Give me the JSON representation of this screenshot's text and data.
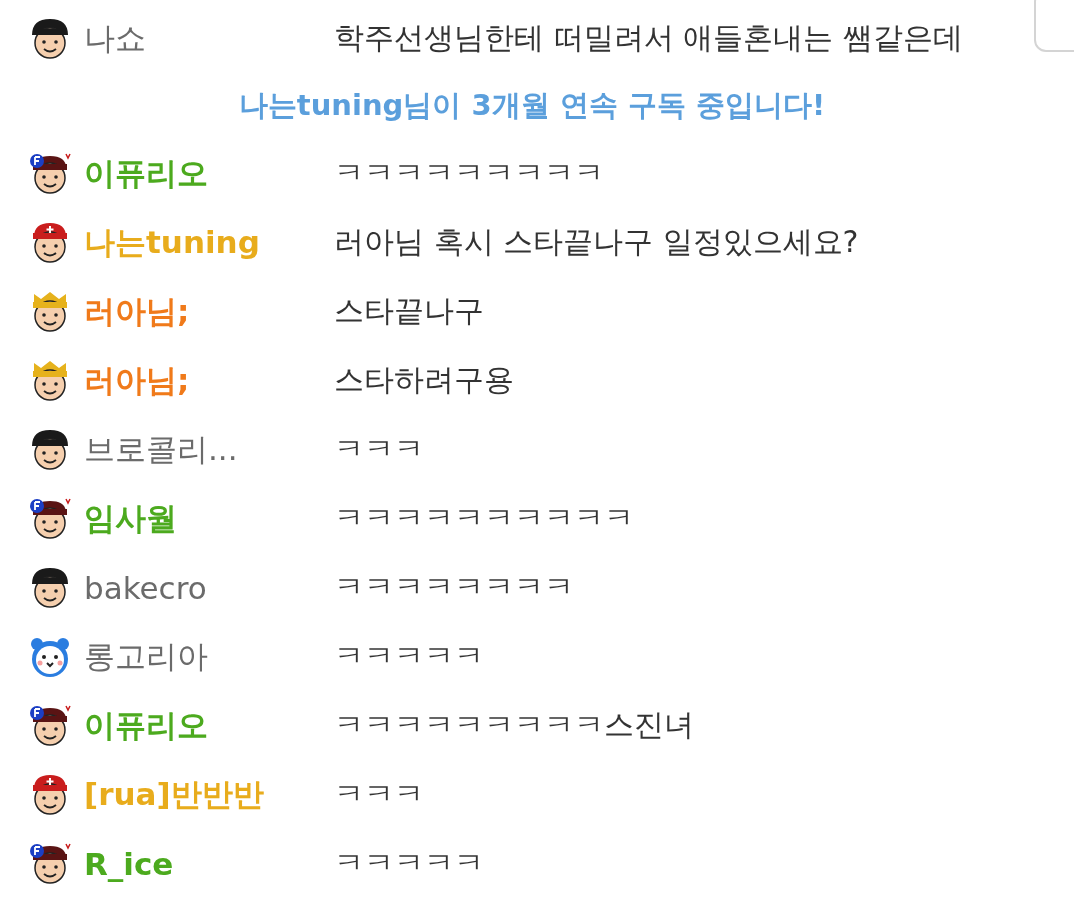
{
  "chat": [
    {
      "kind": "message",
      "avatar": {
        "kind": "plain"
      },
      "name": "나쇼",
      "color": "#6b6b6b",
      "bold": false,
      "text": "학주선생님한테 떠밀려서 애들혼내는 쌤같은데"
    },
    {
      "kind": "notice",
      "text": "나는tuning님이 3개월 연속 구독 중입니다!"
    },
    {
      "kind": "message",
      "avatar": {
        "kind": "fan"
      },
      "name": "이퓨리오",
      "color": "#4caa1e",
      "bold": true,
      "text": "ㅋㅋㅋㅋㅋㅋㅋㅋㅋ"
    },
    {
      "kind": "message",
      "avatar": {
        "kind": "redcap"
      },
      "name": "나는tuning",
      "color": "#e8ac1c",
      "bold": true,
      "text": "러아님 혹시 스타끝나구 일정있으세요?"
    },
    {
      "kind": "message",
      "avatar": {
        "kind": "crown"
      },
      "name": "러아님;",
      "color": "#f07a1a",
      "bold": true,
      "text": "스타끝나구"
    },
    {
      "kind": "message",
      "avatar": {
        "kind": "crown"
      },
      "name": "러아님;",
      "color": "#f07a1a",
      "bold": true,
      "text": "스타하려구용"
    },
    {
      "kind": "message",
      "avatar": {
        "kind": "plain"
      },
      "name": "브로콜리...",
      "color": "#6b6b6b",
      "bold": false,
      "text": "ㅋㅋㅋ"
    },
    {
      "kind": "message",
      "avatar": {
        "kind": "fan"
      },
      "name": "임사월",
      "color": "#4caa1e",
      "bold": true,
      "text": "ㅋㅋㅋㅋㅋㅋㅋㅋㅋㅋ"
    },
    {
      "kind": "message",
      "avatar": {
        "kind": "plain"
      },
      "name": "bakecro",
      "color": "#6b6b6b",
      "bold": false,
      "text": "ㅋㅋㅋㅋㅋㅋㅋㅋ"
    },
    {
      "kind": "message",
      "avatar": {
        "kind": "bear"
      },
      "name": "롱고리아",
      "color": "#6b6b6b",
      "bold": false,
      "text": "ㅋㅋㅋㅋㅋ"
    },
    {
      "kind": "message",
      "avatar": {
        "kind": "fan"
      },
      "name": "이퓨리오",
      "color": "#4caa1e",
      "bold": true,
      "text": "ㅋㅋㅋㅋㅋㅋㅋㅋㅋ스진녀"
    },
    {
      "kind": "message",
      "avatar": {
        "kind": "redcap"
      },
      "name": "[rua]반반반",
      "color": "#e8ac1c",
      "bold": true,
      "text": "ㅋㅋㅋ"
    },
    {
      "kind": "message",
      "avatar": {
        "kind": "fan"
      },
      "name": "R_ice",
      "color": "#4caa1e",
      "bold": true,
      "text": "ㅋㅋㅋㅋㅋ"
    }
  ]
}
